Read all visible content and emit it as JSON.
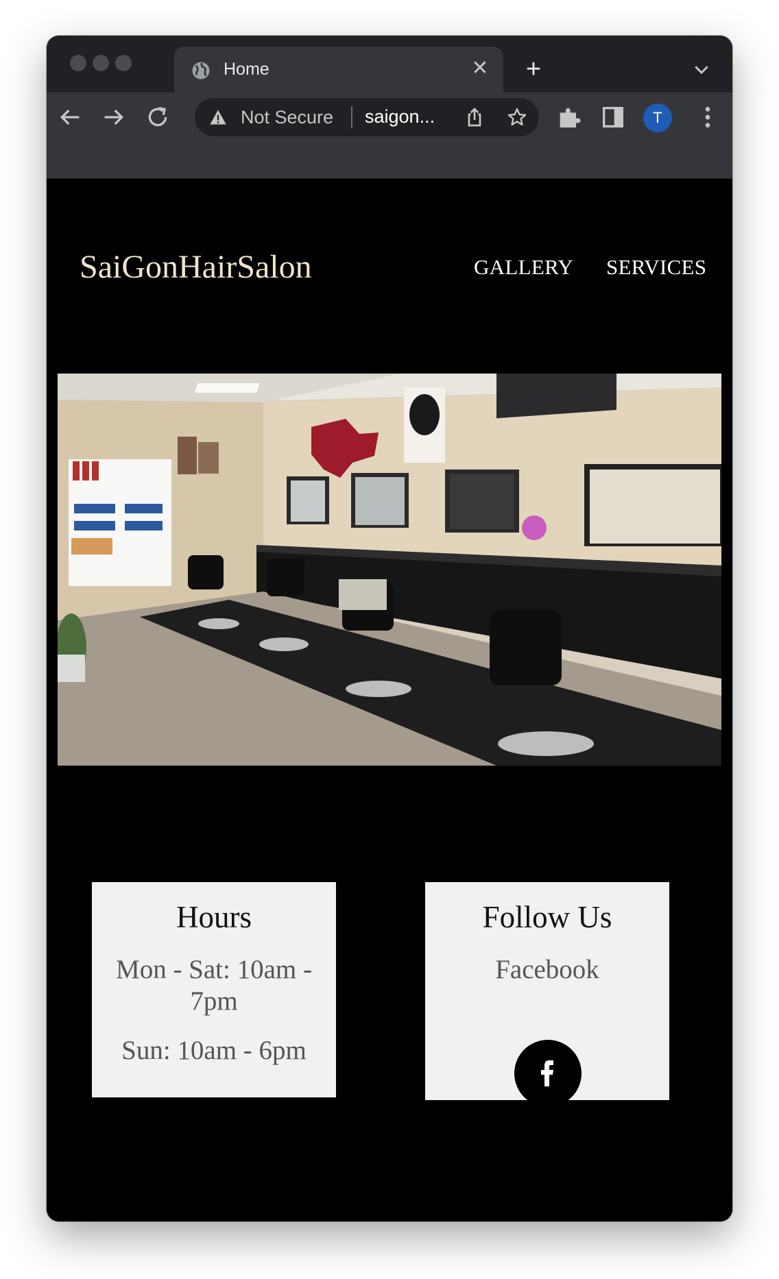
{
  "browser": {
    "tab_title": "Home",
    "omnibox": {
      "security_text": "Not Secure",
      "url_text": "saigon..."
    },
    "profile_initial": "T",
    "accent_color": "#1f5cb5",
    "icons": [
      "globe-icon",
      "close-icon",
      "plus-icon",
      "chevron-down-icon",
      "back-arrow-icon",
      "forward-arrow-icon",
      "reload-icon",
      "warning-icon",
      "share-icon",
      "star-icon",
      "puzzle-icon",
      "side-panel-icon",
      "kebab-menu-icon"
    ]
  },
  "site": {
    "brand": "SaiGonHairSalon",
    "nav": [
      {
        "label": "GALLERY"
      },
      {
        "label": "SERVICES"
      }
    ],
    "hero_alt": "Salon interior",
    "hours": {
      "title": "Hours",
      "weekday": "Mon - Sat: 10am - 7pm",
      "sunday": "Sun: 10am - 6pm"
    },
    "follow": {
      "title": "Follow Us",
      "link": "Facebook",
      "icon": "facebook-icon"
    }
  }
}
